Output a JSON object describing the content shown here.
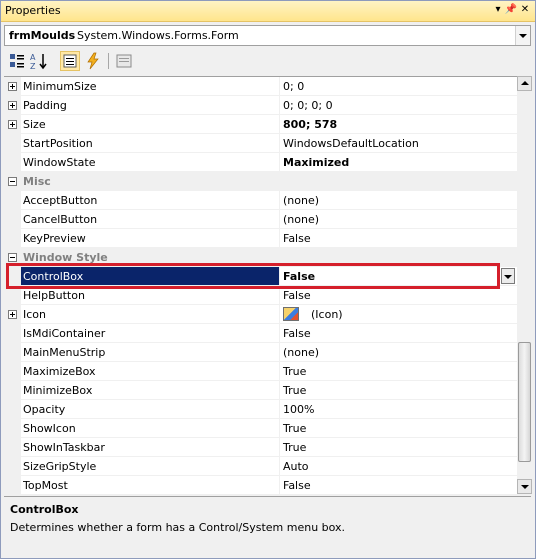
{
  "window": {
    "title": "Properties",
    "pin_glyph": "⊟",
    "close_glyph": "✕"
  },
  "object_selector": {
    "name": "frmMoulds",
    "type": "System.Windows.Forms.Form"
  },
  "properties": [
    {
      "kind": "prop",
      "name": "MinimumSize",
      "value": "0; 0",
      "expandable": true
    },
    {
      "kind": "prop",
      "name": "Padding",
      "value": "0; 0; 0; 0",
      "expandable": true
    },
    {
      "kind": "prop",
      "name": "Size",
      "value": "800; 578",
      "expandable": true,
      "bold": true
    },
    {
      "kind": "prop",
      "name": "StartPosition",
      "value": "WindowsDefaultLocation"
    },
    {
      "kind": "prop",
      "name": "WindowState",
      "value": "Maximized",
      "bold": true
    },
    {
      "kind": "category",
      "name": "Misc",
      "collapse_glyph": "⊟"
    },
    {
      "kind": "prop",
      "name": "AcceptButton",
      "value": "(none)"
    },
    {
      "kind": "prop",
      "name": "CancelButton",
      "value": "(none)"
    },
    {
      "kind": "prop",
      "name": "KeyPreview",
      "value": "False"
    },
    {
      "kind": "category",
      "name": "Window Style",
      "collapse_glyph": "⊟"
    },
    {
      "kind": "prop",
      "name": "ControlBox",
      "value": "False",
      "selected": true,
      "bold": true
    },
    {
      "kind": "prop",
      "name": "HelpButton",
      "value": "False"
    },
    {
      "kind": "prop",
      "name": "Icon",
      "value": "(Icon)",
      "expandable": true,
      "icon": true
    },
    {
      "kind": "prop",
      "name": "IsMdiContainer",
      "value": "False"
    },
    {
      "kind": "prop",
      "name": "MainMenuStrip",
      "value": "(none)"
    },
    {
      "kind": "prop",
      "name": "MaximizeBox",
      "value": "True"
    },
    {
      "kind": "prop",
      "name": "MinimizeBox",
      "value": "True"
    },
    {
      "kind": "prop",
      "name": "Opacity",
      "value": "100%"
    },
    {
      "kind": "prop",
      "name": "ShowIcon",
      "value": "True"
    },
    {
      "kind": "prop",
      "name": "ShowInTaskbar",
      "value": "True"
    },
    {
      "kind": "prop",
      "name": "SizeGripStyle",
      "value": "Auto"
    },
    {
      "kind": "prop",
      "name": "TopMost",
      "value": "False"
    }
  ],
  "description": {
    "title": "ControlBox",
    "text": "Determines whether a form has a Control/System menu box."
  },
  "colors": {
    "selection": "#0a246a",
    "highlight_box": "#d51f2b"
  }
}
